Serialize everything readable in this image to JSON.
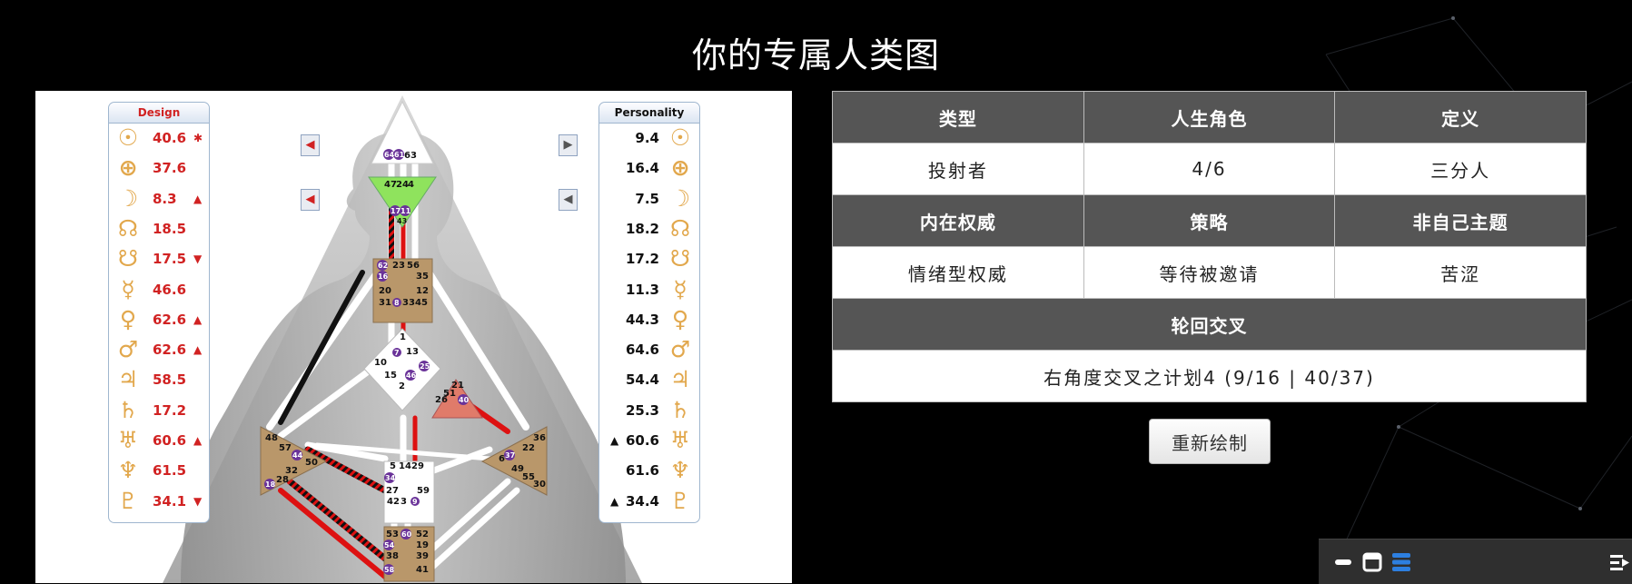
{
  "page": {
    "title": "你的专属人类图"
  },
  "design": {
    "header": "Design",
    "planets": [
      {
        "icon": "sun-icon",
        "glyph": "☉",
        "value": "40.6",
        "mark": "✱"
      },
      {
        "icon": "earth-icon",
        "glyph": "⊕",
        "value": "37.6",
        "mark": ""
      },
      {
        "icon": "moon-icon",
        "glyph": "☽",
        "value": "8.3",
        "mark": "▲"
      },
      {
        "icon": "north-node-icon",
        "glyph": "☊",
        "value": "18.5",
        "mark": ""
      },
      {
        "icon": "south-node-icon",
        "glyph": "☋",
        "value": "17.5",
        "mark": "▼"
      },
      {
        "icon": "mercury-icon",
        "glyph": "☿",
        "value": "46.6",
        "mark": ""
      },
      {
        "icon": "venus-icon",
        "glyph": "♀",
        "value": "62.6",
        "mark": "▲"
      },
      {
        "icon": "mars-icon",
        "glyph": "♂",
        "value": "62.6",
        "mark": "▲"
      },
      {
        "icon": "jupiter-icon",
        "glyph": "♃",
        "value": "58.5",
        "mark": ""
      },
      {
        "icon": "saturn-icon",
        "glyph": "♄",
        "value": "17.2",
        "mark": ""
      },
      {
        "icon": "uranus-icon",
        "glyph": "♅",
        "value": "60.6",
        "mark": "▲"
      },
      {
        "icon": "neptune-icon",
        "glyph": "♆",
        "value": "61.5",
        "mark": ""
      },
      {
        "icon": "pluto-icon",
        "glyph": "♇",
        "value": "34.1",
        "mark": "▼"
      }
    ]
  },
  "personality": {
    "header": "Personality",
    "planets": [
      {
        "icon": "sun-icon",
        "glyph": "☉",
        "value": "9.4",
        "mark": ""
      },
      {
        "icon": "earth-icon",
        "glyph": "⊕",
        "value": "16.4",
        "mark": ""
      },
      {
        "icon": "moon-icon",
        "glyph": "☽",
        "value": "7.5",
        "mark": ""
      },
      {
        "icon": "north-node-icon",
        "glyph": "☊",
        "value": "18.2",
        "mark": ""
      },
      {
        "icon": "south-node-icon",
        "glyph": "☋",
        "value": "17.2",
        "mark": ""
      },
      {
        "icon": "mercury-icon",
        "glyph": "☿",
        "value": "11.3",
        "mark": ""
      },
      {
        "icon": "venus-icon",
        "glyph": "♀",
        "value": "44.3",
        "mark": ""
      },
      {
        "icon": "mars-icon",
        "glyph": "♂",
        "value": "64.6",
        "mark": ""
      },
      {
        "icon": "jupiter-icon",
        "glyph": "♃",
        "value": "54.4",
        "mark": ""
      },
      {
        "icon": "saturn-icon",
        "glyph": "♄",
        "value": "25.3",
        "mark": ""
      },
      {
        "icon": "uranus-icon",
        "glyph": "♅",
        "value": "60.6",
        "mark": "▲"
      },
      {
        "icon": "neptune-icon",
        "glyph": "♆",
        "value": "61.6",
        "mark": ""
      },
      {
        "icon": "pluto-icon",
        "glyph": "♇",
        "value": "34.4",
        "mark": "▲"
      }
    ]
  },
  "bodygraph": {
    "head_gates": [
      "64",
      "61",
      "63"
    ],
    "ajna_gates": [
      "47",
      "24",
      "4",
      "17",
      "11",
      "43"
    ],
    "throat_gates": [
      "62",
      "23",
      "56",
      "16",
      "35",
      "20",
      "12",
      "31",
      "8",
      "33",
      "45"
    ],
    "g_gates": [
      "1",
      "7",
      "13",
      "10",
      "25",
      "15",
      "46",
      "2"
    ],
    "ego_gates": [
      "21",
      "51",
      "26",
      "40"
    ],
    "spleen_gates": [
      "48",
      "57",
      "44",
      "50",
      "32",
      "28",
      "18"
    ],
    "sacral_gates": [
      "5",
      "14",
      "29",
      "34",
      "27",
      "59",
      "42",
      "3",
      "9"
    ],
    "solar_gates": [
      "36",
      "22",
      "37",
      "6",
      "49",
      "55",
      "30"
    ],
    "root_gates": [
      "53",
      "60",
      "52",
      "54",
      "19",
      "38",
      "39",
      "58",
      "41"
    ],
    "colors": {
      "defined": "#b9976a",
      "ajna": "#8fe35d",
      "ego": "#e07b6a",
      "activation_red": "#dd1111",
      "circle": "#6a3399"
    }
  },
  "table": {
    "headers_row1": [
      "类型",
      "人生角色",
      "定义"
    ],
    "values_row1": [
      "投射者",
      "4/6",
      "三分人"
    ],
    "headers_row2": [
      "内在权威",
      "策略",
      "非自己主题"
    ],
    "values_row2": [
      "情绪型权威",
      "等待被邀请",
      "苦涩"
    ],
    "cross_header": "轮回交叉",
    "cross_value": "右角度交叉之计划4 (9/16 | 40/37)"
  },
  "redraw_label": "重新绘制",
  "dock": {
    "icons": [
      "minimize-icon",
      "window-icon",
      "layers-icon",
      "expand-icon"
    ],
    "accent": "#2d7fe0"
  }
}
